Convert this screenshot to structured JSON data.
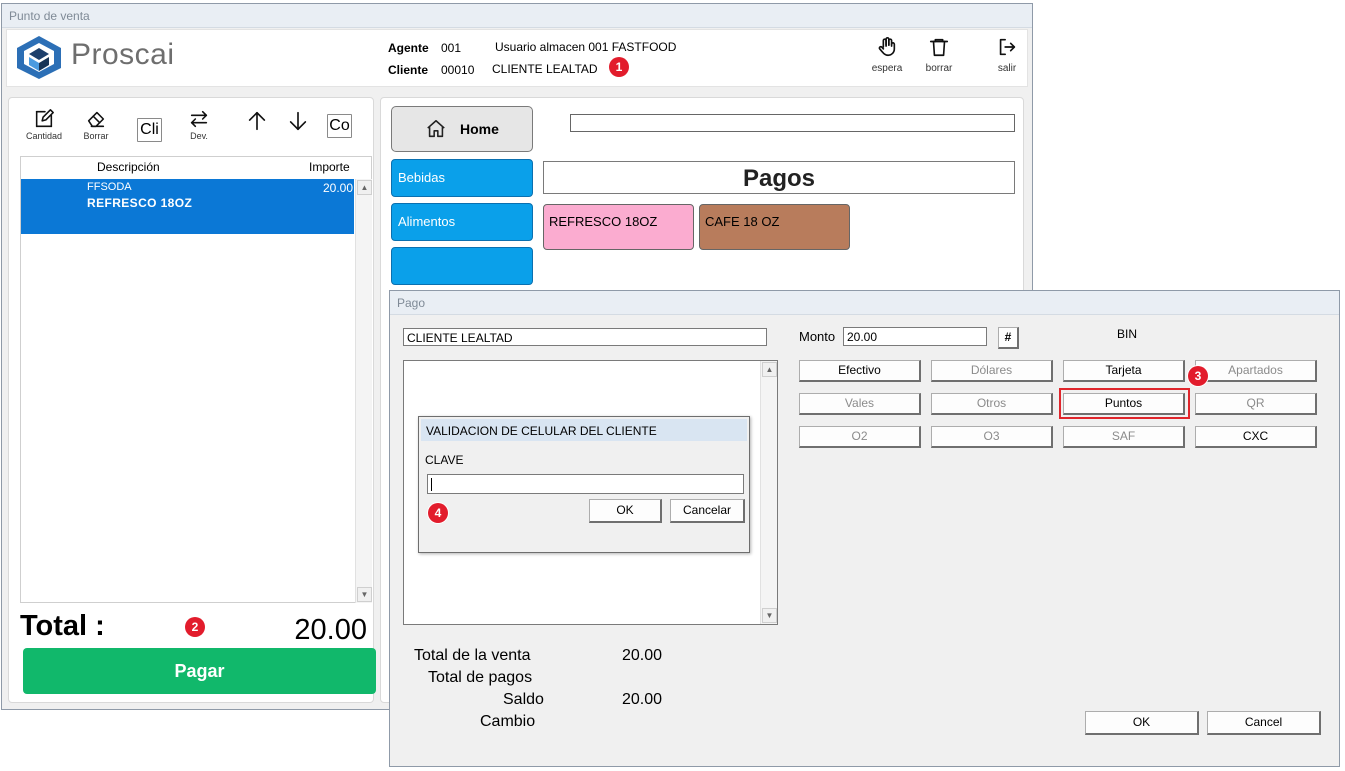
{
  "main_window": {
    "title": "Punto de venta",
    "brand": "Proscai",
    "agent_label": "Agente",
    "agent_code": "001",
    "agent_name": "Usuario almacen 001 FASTFOOD",
    "client_label": "Cliente",
    "client_code": "00010",
    "client_name": "CLIENTE LEALTAD",
    "toolbar": [
      {
        "label": "espera",
        "icon": "hand-icon"
      },
      {
        "label": "borrar",
        "icon": "trash-icon"
      },
      {
        "label": "salir",
        "icon": "logout-icon"
      }
    ]
  },
  "ticket": {
    "tools": [
      {
        "label": "Cantidad",
        "icon": "edit-icon"
      },
      {
        "label": "Borrar",
        "icon": "eraser-icon"
      },
      {
        "label": "Cli",
        "icon": ""
      },
      {
        "label": "Dev.",
        "icon": "swap-icon"
      },
      {
        "label": "",
        "icon": "arrow-up-icon"
      },
      {
        "label": "",
        "icon": "arrow-down-icon"
      },
      {
        "label": "Co",
        "icon": ""
      }
    ],
    "col_description": "Descripción",
    "col_amount": "Importe",
    "items": [
      {
        "code": "FFSODA",
        "name": "REFRESCO 18OZ",
        "amount": "20.00"
      }
    ],
    "total_label": "Total :",
    "total_value": "20.00",
    "pay_button": "Pagar"
  },
  "catalog": {
    "home_label": "Home",
    "categories": [
      "Bebidas",
      "Alimentos",
      ""
    ],
    "search_value": "",
    "section_title": "Pagos",
    "products": [
      {
        "name": "REFRESCO 18OZ",
        "color": "#fbacd0"
      },
      {
        "name": "CAFE 18 OZ",
        "color": "#b87c5c"
      }
    ]
  },
  "payment_dialog": {
    "title": "Pago",
    "client_name": "CLIENTE LEALTAD",
    "amount_label": "Monto",
    "amount_value": "20.00",
    "hash_button": "#",
    "bin_label": "BIN",
    "methods": [
      {
        "label": "Efectivo",
        "enabled": true
      },
      {
        "label": "Dólares",
        "enabled": false
      },
      {
        "label": "Tarjeta",
        "enabled": true
      },
      {
        "label": "Apartados",
        "enabled": false
      },
      {
        "label": "Vales",
        "enabled": false
      },
      {
        "label": "Otros",
        "enabled": false
      },
      {
        "label": "Puntos",
        "enabled": true,
        "highlighted": true
      },
      {
        "label": "QR",
        "enabled": false
      },
      {
        "label": "O2",
        "enabled": false
      },
      {
        "label": "O3",
        "enabled": false
      },
      {
        "label": "SAF",
        "enabled": false
      },
      {
        "label": "CXC",
        "enabled": true
      }
    ],
    "summary": [
      {
        "label": "Total de la venta",
        "value": "20.00"
      },
      {
        "label": "Total de pagos",
        "value": ""
      },
      {
        "label": "Saldo",
        "value": "20.00"
      },
      {
        "label": "Cambio",
        "value": ""
      }
    ],
    "ok_button": "OK",
    "cancel_button": "Cancel"
  },
  "validation_dialog": {
    "title": "VALIDACION DE CELULAR DEL CLIENTE",
    "field_label": "CLAVE",
    "field_value": "",
    "ok_button": "OK",
    "cancel_button": "Cancelar"
  },
  "badges": [
    "1",
    "2",
    "3",
    "4"
  ],
  "colors": {
    "selected_row": "#0b78d6",
    "pay_button": "#11b86b",
    "category": "#0aa0ea",
    "badge": "#e21c2c",
    "highlight": "#e0262c"
  }
}
